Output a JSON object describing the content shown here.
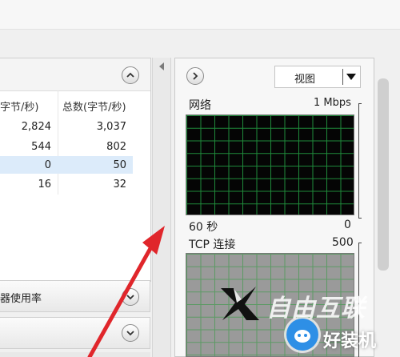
{
  "colors": {
    "annotation_arrow": "#e0262b",
    "network_graph_bg": "#050505",
    "network_grid": "#1f8a3a",
    "tcp_graph_bg": "#9a9a9a",
    "highlight_row": "#dcebfa",
    "watermark_blue": "#2e8fe6"
  },
  "left_panel": {
    "columns": [
      "字节/秒)",
      "总数(字节/秒)"
    ],
    "rows": [
      {
        "c1": "2,824",
        "c2": "3,037"
      },
      {
        "c1": "544",
        "c2": "802"
      },
      {
        "c1": "0",
        "c2": "50"
      },
      {
        "c1": "16",
        "c2": "32"
      }
    ],
    "collapse_icon": "chevron-up-icon"
  },
  "sections": {
    "disk_usage_label": "器使用率",
    "expand_icon": "chevron-down-icon"
  },
  "right_panel": {
    "toggle_icon": "chevron-right-icon",
    "view_button_label": "视图",
    "view_dropdown_icon": "triangle-down-icon",
    "network": {
      "label": "网络",
      "scale": "1 Mbps",
      "time_label": "60 秒",
      "min_value": "0"
    },
    "tcp": {
      "label": "TCP 连接",
      "max_value": "500"
    }
  },
  "watermarks": {
    "brand1": "自由互联",
    "brand2": "好装机"
  }
}
